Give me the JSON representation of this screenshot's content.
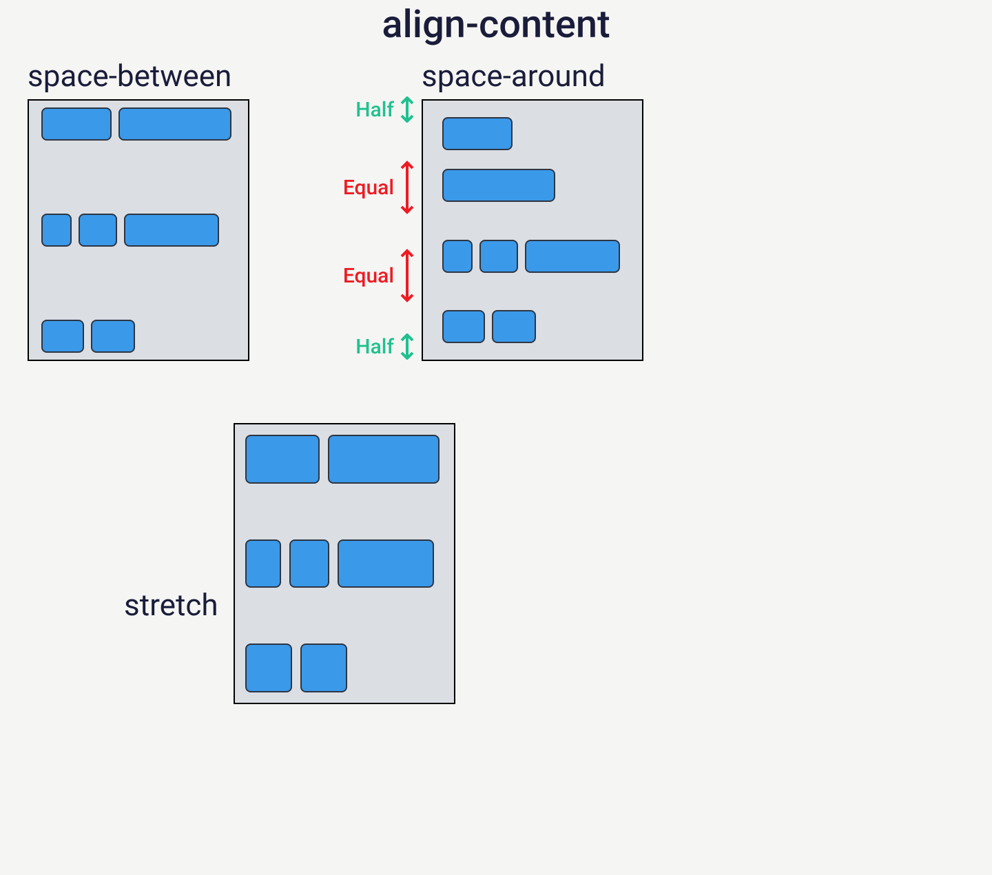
{
  "title": "align-content",
  "examples": {
    "space_between": {
      "label": "space-between",
      "rows": [
        [
          102,
          164
        ],
        [
          44,
          56,
          138
        ],
        [
          62,
          64
        ]
      ]
    },
    "space_around": {
      "label": "space-around",
      "rows": [
        [
          102,
          164
        ],
        [
          44,
          56,
          138
        ],
        [
          62,
          64
        ]
      ],
      "annotations": [
        {
          "text": "Half",
          "color": "green",
          "size": "half"
        },
        {
          "text": "Equal",
          "color": "red",
          "size": "equal"
        },
        {
          "text": "Equal",
          "color": "red",
          "size": "equal"
        },
        {
          "text": "Half",
          "color": "green",
          "size": "half"
        }
      ]
    },
    "stretch": {
      "label": "stretch",
      "rows": [
        [
          108,
          162
        ],
        [
          52,
          58,
          140
        ],
        [
          68,
          68
        ]
      ]
    }
  }
}
